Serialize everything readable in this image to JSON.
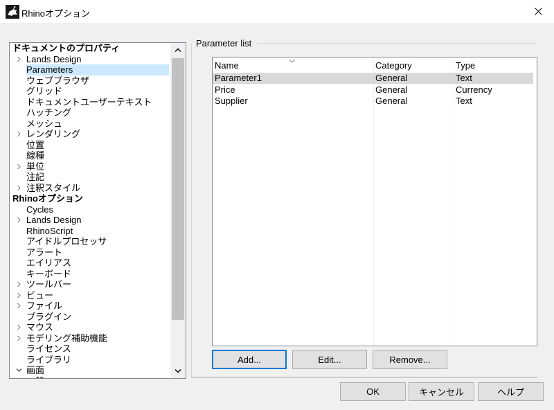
{
  "window": {
    "title": "Rhinoオプション",
    "close_glyph": "✕"
  },
  "tree": {
    "items": [
      {
        "label": "ドキュメントのプロパティ",
        "level": 0,
        "expander": ""
      },
      {
        "label": "Lands Design",
        "level": 1,
        "expander": "collapsed"
      },
      {
        "label": "Parameters",
        "level": 1,
        "expander": "",
        "selected": true
      },
      {
        "label": "ウェブブラウザ",
        "level": 1,
        "expander": ""
      },
      {
        "label": "グリッド",
        "level": 1,
        "expander": ""
      },
      {
        "label": "ドキュメントユーザーテキスト",
        "level": 1,
        "expander": ""
      },
      {
        "label": "ハッチング",
        "level": 1,
        "expander": ""
      },
      {
        "label": "メッシュ",
        "level": 1,
        "expander": ""
      },
      {
        "label": "レンダリング",
        "level": 1,
        "expander": "collapsed"
      },
      {
        "label": "位置",
        "level": 1,
        "expander": ""
      },
      {
        "label": "線種",
        "level": 1,
        "expander": ""
      },
      {
        "label": "単位",
        "level": 1,
        "expander": "collapsed"
      },
      {
        "label": "注記",
        "level": 1,
        "expander": ""
      },
      {
        "label": "注釈スタイル",
        "level": 1,
        "expander": "collapsed"
      },
      {
        "label": "Rhinoオプション",
        "level": 0,
        "expander": ""
      },
      {
        "label": "Cycles",
        "level": 1,
        "expander": ""
      },
      {
        "label": "Lands Design",
        "level": 1,
        "expander": "collapsed"
      },
      {
        "label": "RhinoScript",
        "level": 1,
        "expander": ""
      },
      {
        "label": "アイドルプロセッサ",
        "level": 1,
        "expander": ""
      },
      {
        "label": "アラート",
        "level": 1,
        "expander": ""
      },
      {
        "label": "エイリアス",
        "level": 1,
        "expander": ""
      },
      {
        "label": "キーボード",
        "level": 1,
        "expander": ""
      },
      {
        "label": "ツールバー",
        "level": 1,
        "expander": "collapsed"
      },
      {
        "label": "ビュー",
        "level": 1,
        "expander": "collapsed"
      },
      {
        "label": "ファイル",
        "level": 1,
        "expander": "collapsed"
      },
      {
        "label": "プラグイン",
        "level": 1,
        "expander": ""
      },
      {
        "label": "マウス",
        "level": 1,
        "expander": "collapsed"
      },
      {
        "label": "モデリング補助機能",
        "level": 1,
        "expander": "collapsed"
      },
      {
        "label": "ライセンス",
        "level": 1,
        "expander": ""
      },
      {
        "label": "ライブラリ",
        "level": 1,
        "expander": ""
      },
      {
        "label": "画面",
        "level": 1,
        "expander": "expanded"
      },
      {
        "label": "一般",
        "level": 1,
        "expander": ""
      }
    ]
  },
  "parameter_group": {
    "label": "Parameter list",
    "columns": [
      "Name",
      "Category",
      "Type"
    ],
    "rows": [
      {
        "name": "Parameter1",
        "category": "General",
        "type": "Text",
        "selected": true
      },
      {
        "name": "Price",
        "category": "General",
        "type": "Currency"
      },
      {
        "name": "Supplier",
        "category": "General",
        "type": "Text"
      }
    ],
    "buttons": {
      "add": "Add...",
      "edit": "Edit...",
      "remove": "Remove..."
    }
  },
  "footer": {
    "ok": "OK",
    "cancel": "キャンセル",
    "help": "ヘルプ"
  },
  "colors": {
    "selection_tree": "#cce8ff",
    "selection_list": "#d9d9d9",
    "dialog_bg": "#f0f0f0"
  }
}
